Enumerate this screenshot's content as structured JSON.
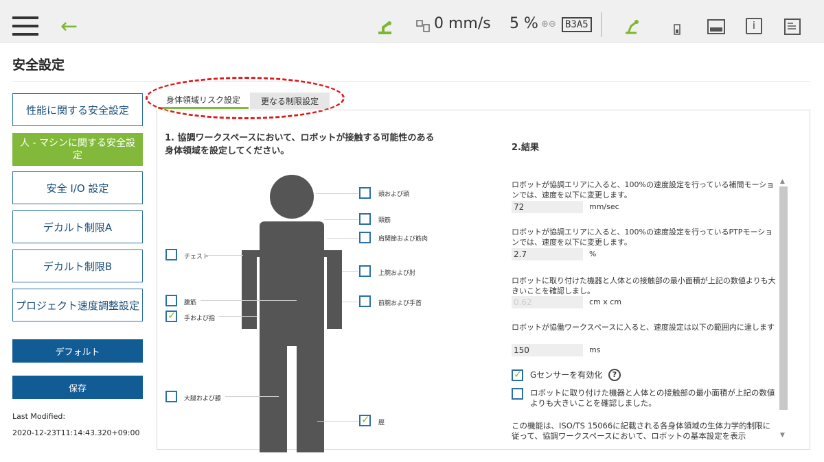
{
  "topbar": {
    "speed": "0 mm/s",
    "percent": "5 %",
    "tag": "B3A5"
  },
  "page_title": "安全設定",
  "sidebar": {
    "items": [
      {
        "label": "性能に関する安全設定"
      },
      {
        "label": "人 - マシンに関する安全設定"
      },
      {
        "label": "安全 I/O 設定"
      },
      {
        "label": "デカルト制限A"
      },
      {
        "label": "デカルト制限B"
      },
      {
        "label": "プロジェクト速度調整設定"
      }
    ],
    "default_label": "デフォルト",
    "save_label": "保存",
    "last_modified_label": "Last Modified:",
    "last_modified_value": "2020-12-23T11:14:43.320+09:00"
  },
  "tabs": [
    {
      "label": "身体領域リスク設定"
    },
    {
      "label": "更なる制限設定"
    }
  ],
  "section1": {
    "title": "1. 協調ワークスペースにおいて、ロボットが接触する可能性のある身体領域を設定してください。"
  },
  "body_regions": [
    {
      "label": "頭および頭",
      "checked": false
    },
    {
      "label": "頸筋",
      "checked": false
    },
    {
      "label": "肩関節および筋肉",
      "checked": false
    },
    {
      "label": "チェスト",
      "checked": false
    },
    {
      "label": "上腕および肘",
      "checked": false
    },
    {
      "label": "腹筋",
      "checked": false
    },
    {
      "label": "前腕および手首",
      "checked": false
    },
    {
      "label": "手および指",
      "checked": true
    },
    {
      "label": "大腿および膝",
      "checked": false
    },
    {
      "label": "脛",
      "checked": true
    }
  ],
  "section2": {
    "title": "2.結果",
    "items": [
      {
        "text": "ロボットが協調エリアに入ると、100%の速度設定を行っている補間モーションでは、速度を以下に変更します。",
        "value": "72",
        "unit": "mm/sec"
      },
      {
        "text": "ロボットが協調エリアに入ると、100%の速度設定を行っているPTPモーションでは、速度を以下に変更します。",
        "value": "2.7",
        "unit": "%"
      },
      {
        "text": "ロボットに取り付けた機器と人体との接触部の最小面積が上記の数値よりも大きいことを確認しまし。",
        "value": "0.62",
        "unit": "cm x cm"
      },
      {
        "text": "ロボットが協働ワークスペースに入ると、速度設定は以下の範囲内に達します",
        "value": "150",
        "unit": "ms"
      }
    ],
    "g_sensor_label": "Gセンサーを有効化",
    "g_sensor_checked": true,
    "help_glyph": "?",
    "confirm_label": "ロボットに取り付けた機器と人体との接触部の最小面積が上記の数値よりも大きいことを確認しました。",
    "confirm_checked": false,
    "footer_text": "この機能は、ISO/TS 15066に記載される各身体領域の生体力学的制限に従って、協調ワークスペースにおいて、ロボットの基本設定を表示"
  },
  "colors": {
    "accent_green": "#82b93a",
    "nav_blue": "#125c96",
    "annotation_red": "#e01a1a"
  }
}
